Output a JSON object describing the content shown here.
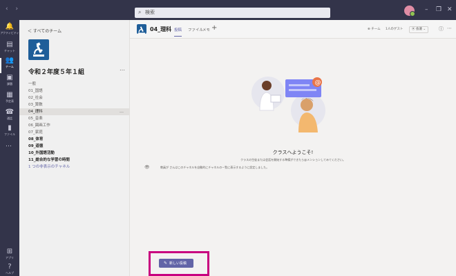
{
  "topbar": {
    "nav_arrows": "‹ ›",
    "search_placeholder": "検索",
    "window_controls": [
      "–",
      "❐",
      "✕"
    ]
  },
  "rail": {
    "items": [
      {
        "label": "アクティビティ",
        "icon": "bell-icon",
        "glyph": "🔔"
      },
      {
        "label": "チャット",
        "icon": "chat-icon",
        "glyph": "▤"
      },
      {
        "label": "チーム",
        "icon": "teams-icon",
        "glyph": "👥"
      },
      {
        "label": "課題",
        "icon": "assignments-icon",
        "glyph": "▣"
      },
      {
        "label": "予定表",
        "icon": "calendar-icon",
        "glyph": "▦"
      },
      {
        "label": "通話",
        "icon": "phone-icon",
        "glyph": "☎"
      },
      {
        "label": "ファイル",
        "icon": "files-icon",
        "glyph": "▮"
      }
    ],
    "more": "…",
    "bottom": [
      {
        "label": "アプリ",
        "icon": "apps-icon",
        "glyph": "⊞"
      },
      {
        "label": "ヘルプ",
        "icon": "help-icon",
        "glyph": "?"
      }
    ]
  },
  "sidebar": {
    "back_label": "＜ すべてのチーム",
    "team_name": "令和２年度５年１組",
    "more": "…",
    "channels": [
      {
        "label": "一般",
        "bold": false
      },
      {
        "label": "01_国語",
        "bold": false
      },
      {
        "label": "02_社会",
        "bold": false
      },
      {
        "label": "03_算数",
        "bold": false
      },
      {
        "label": "04_理科",
        "bold": false,
        "selected": true
      },
      {
        "label": "05_音楽",
        "bold": false
      },
      {
        "label": "06_図画工作",
        "bold": false
      },
      {
        "label": "07_家庭",
        "bold": false
      },
      {
        "label": "08_体育",
        "bold": true
      },
      {
        "label": "09_道徳",
        "bold": true
      },
      {
        "label": "10_外国語活動",
        "bold": true
      },
      {
        "label": "11_総合的な学習の時間",
        "bold": true
      }
    ],
    "hidden_channels_link": "1 つの非表示のチャネル"
  },
  "header": {
    "channel_title": "04_理科",
    "tabs": [
      {
        "label": "投稿",
        "active": true
      },
      {
        "label": "ファイル",
        "active": false
      },
      {
        "label": "メモ",
        "active": false
      }
    ],
    "add_tab": "+",
    "team_label": "⊕ チーム",
    "guest_label": "1人のゲスト",
    "meet_label": "⦿ 会議",
    "chevron": "⌄",
    "info": "ⓘ",
    "more": "⋯"
  },
  "main": {
    "welcome_title": "クラスへようこそ!",
    "welcome_desc": "クラスの生徒または会話を開始する準備ができたら@メンションしてみてください。",
    "notice": "教員が さんはこのチャネルを自動的にチャネルの一覧に表示するように設定しました。",
    "new_post_label": "新しい投稿",
    "mention_glyph": "@"
  },
  "colors": {
    "rail": "#33344a",
    "accent": "#6264a7",
    "highlight": "#c8007f",
    "team_avatar": "#1f5e99"
  }
}
